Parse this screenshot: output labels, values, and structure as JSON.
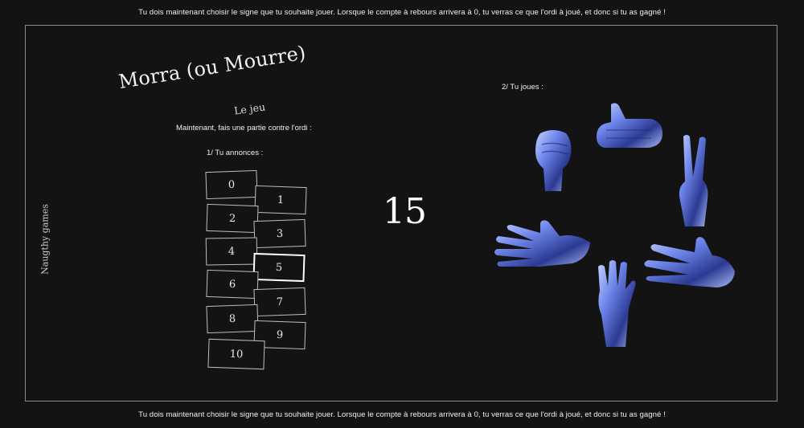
{
  "banner_text": "Tu dois maintenant choisir le signe que tu souhaite jouer. Lorsque le compte à rebours arrivera à 0, tu verras ce que l'ordi à joué, et donc si tu as gagné !",
  "side_label": "Naugthy games",
  "title": "Morra (ou Mourre)",
  "subtitle": "Le jeu",
  "intro": "Maintenant, fais une partie contre l'ordi :",
  "announce_label": "1/ Tu annonces :",
  "play_label": "2/ Tu joues :",
  "countdown": "15",
  "cards": [
    "0",
    "1",
    "2",
    "3",
    "4",
    "5",
    "6",
    "7",
    "8",
    "9",
    "10"
  ],
  "selected_card": "5",
  "hands": [
    {
      "name": "fist",
      "fingers": 0
    },
    {
      "name": "thumb",
      "fingers": 1
    },
    {
      "name": "peace",
      "fingers": 2
    },
    {
      "name": "open-palm",
      "fingers": 5
    },
    {
      "name": "raised-hand",
      "fingers": 5
    },
    {
      "name": "three-fingers",
      "fingers": 3
    }
  ],
  "hand_colors": {
    "light": "#b9c8ff",
    "mid": "#6f86e8",
    "dark": "#2c3a8f"
  }
}
